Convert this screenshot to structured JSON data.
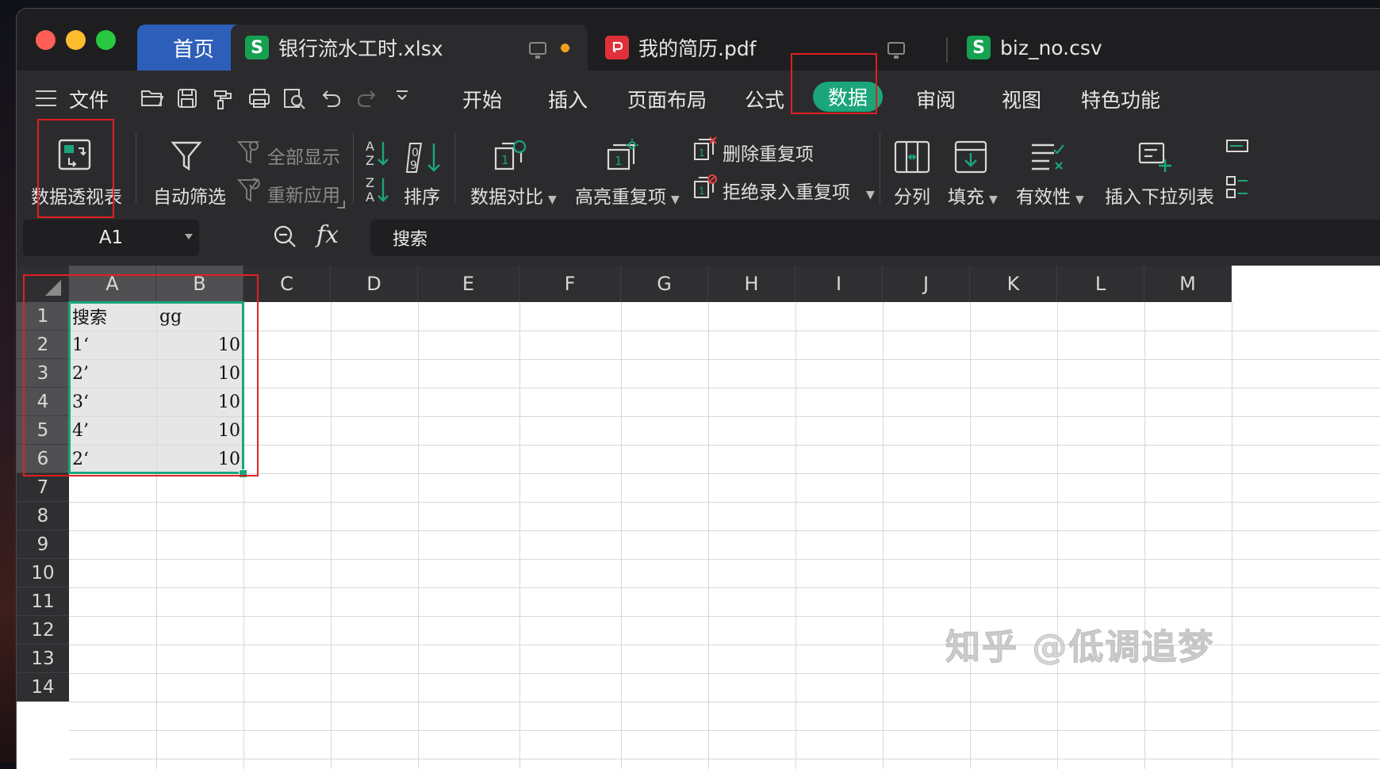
{
  "tabs": {
    "home": "首页",
    "file1": "银行流水工时.xlsx",
    "file2": "我的简历.pdf",
    "file3": "biz_no.csv",
    "icon_s": "S"
  },
  "menu": {
    "file": "文件",
    "items": [
      "开始",
      "插入",
      "页面布局",
      "公式",
      "数据",
      "审阅",
      "视图",
      "特色功能"
    ],
    "active": "数据"
  },
  "ribbon": {
    "pivot": "数据透视表",
    "autofilter": "自动筛选",
    "show_all": "全部显示",
    "reapply": "重新应用",
    "sort": "排序",
    "compare": "数据对比",
    "highlight_dup": "高亮重复项",
    "remove_dup": "删除重复项",
    "reject_dup": "拒绝录入重复项",
    "split": "分列",
    "fill": "填充",
    "validity": "有效性",
    "dropdown": "插入下拉列表"
  },
  "formula": {
    "namebox": "A1",
    "fx": "fx",
    "content": "搜索"
  },
  "grid": {
    "columns": [
      "A",
      "B",
      "C",
      "D",
      "E",
      "F",
      "G",
      "H",
      "I",
      "J",
      "K",
      "L",
      "M"
    ],
    "rows": [
      "1",
      "2",
      "3",
      "4",
      "5",
      "6",
      "7",
      "8",
      "9",
      "10",
      "11",
      "12",
      "13",
      "14"
    ],
    "cells": [
      [
        "搜索",
        "gg"
      ],
      [
        "1‘",
        "10"
      ],
      [
        "2’",
        "10"
      ],
      [
        "3‘",
        "10"
      ],
      [
        "4’",
        "10"
      ],
      [
        "2‘",
        "10"
      ]
    ]
  },
  "watermark": "知乎 @低调追梦",
  "colors": {
    "accent": "#1aa67a",
    "home_tab": "#2e5fb8",
    "annotation": "#e02020"
  }
}
